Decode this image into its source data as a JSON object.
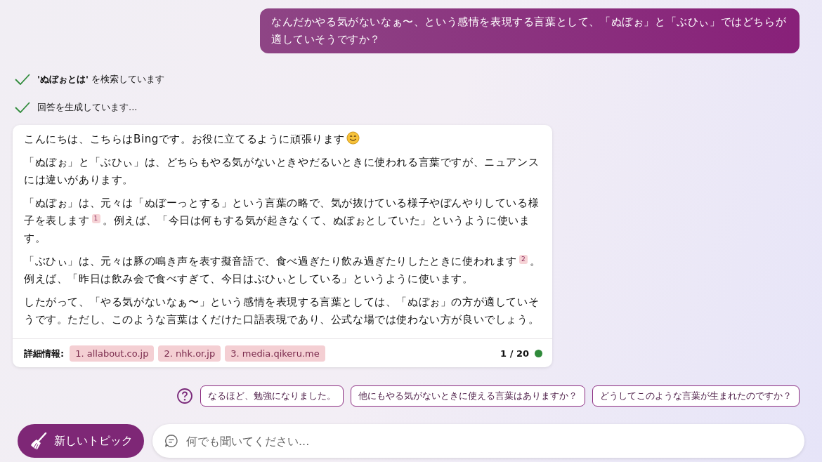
{
  "user_message": "なんだかやる気がないなぁ〜、という感情を表現する言葉として、「ぬぼぉ」と「ぶひぃ」ではどちらが適していそうですか？",
  "steps": [
    {
      "text": "**'ぬぼぉとは'** を検索しています",
      "done": true
    },
    {
      "text": "回答を生成しています...",
      "done": true
    }
  ],
  "answer": {
    "paragraphs": [
      [
        {
          "kind": "text",
          "text": "こんにちは、こちらはBingです。お役に立てるように頑張ります"
        },
        {
          "kind": "emoji"
        }
      ],
      [
        {
          "kind": "text",
          "text": "「ぬぼぉ」と「ぶひぃ」は、どちらもやる気がないときやだるいときに使われる言葉ですが、ニュアンスには違いがあります。"
        }
      ],
      [
        {
          "kind": "text",
          "text": "「ぬぼぉ」は、元々は「ぬぼーっとする」という言葉の略で、気が抜けている様子やぼんやりしている様子を表します"
        },
        {
          "kind": "cite",
          "text": "1"
        },
        {
          "kind": "text",
          "text": "。例えば、「今日は何もする気が起きなくて、ぬぼぉとしていた」というように使います。"
        }
      ],
      [
        {
          "kind": "text",
          "text": "「ぶひぃ」は、元々は豚の鳴き声を表す擬音語で、食べ過ぎたり飲み過ぎたりしたときに使われます"
        },
        {
          "kind": "cite",
          "text": "2"
        },
        {
          "kind": "text",
          "text": "。例えば、「昨日は飲み会で食べすぎて、今日はぶひぃとしている」というように使います。"
        }
      ],
      [
        {
          "kind": "text",
          "text": "したがって、「やる気がないなぁ〜」という感情を表現する言葉としては、「ぬぼぉ」の方が適していそうです。ただし、このような言葉はくだけた口語表現であり、公式な場では使わない方が良いでしょう。"
        }
      ]
    ],
    "sources_label": "詳細情報:",
    "sources": [
      "1. allabout.co.jp",
      "2. nhk.or.jp",
      "3. media.qikeru.me"
    ],
    "counter": "1 / 20"
  },
  "suggestions": [
    "なるほど、勉強になりました。",
    "他にもやる気がないときに使える言葉はありますか？",
    "どうしてこのような言葉が生まれたのですか？"
  ],
  "new_topic_button": "新しいトピック",
  "input": {
    "placeholder": "何でも聞いてください..."
  }
}
